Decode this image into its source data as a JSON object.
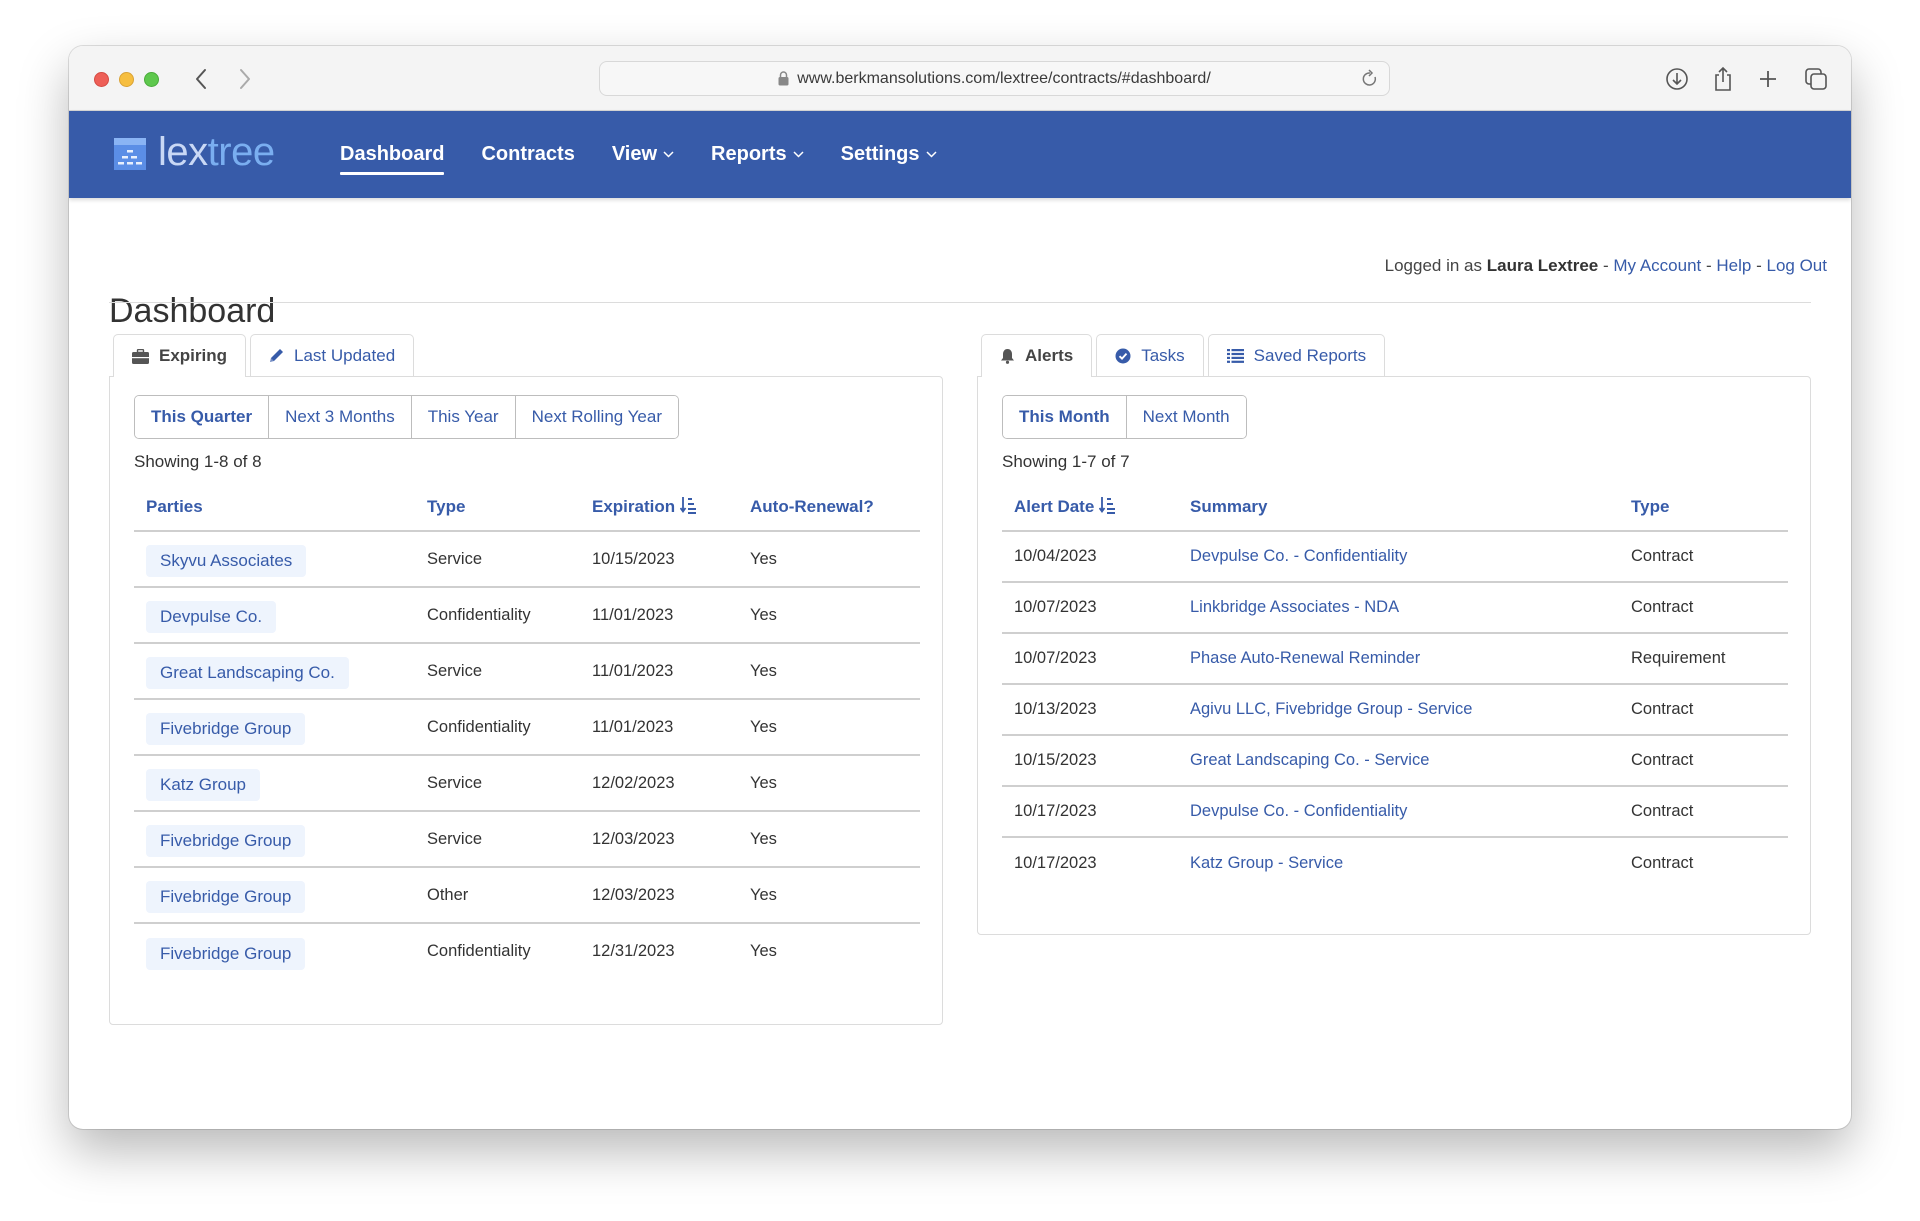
{
  "browser": {
    "url": "www.berkmansolutions.com/lextree/contracts/#dashboard/"
  },
  "app": {
    "logo": {
      "part1": "lex",
      "part2": "tree"
    },
    "nav": [
      {
        "label": "Dashboard",
        "active": true,
        "dropdown": false
      },
      {
        "label": "Contracts",
        "active": false,
        "dropdown": false
      },
      {
        "label": "View",
        "active": false,
        "dropdown": true
      },
      {
        "label": "Reports",
        "active": false,
        "dropdown": true
      },
      {
        "label": "Settings",
        "active": false,
        "dropdown": true
      }
    ],
    "colors": {
      "brand": "#375ba9",
      "badge_bg": "#eef4fd"
    }
  },
  "userbar": {
    "prefix": "Logged in as",
    "user": "Laura Lextree",
    "sep": "-",
    "links": [
      "My Account",
      "Help",
      "Log Out"
    ]
  },
  "page": {
    "title": "Dashboard"
  },
  "left_panel": {
    "tabs": [
      {
        "label": "Expiring",
        "icon": "briefcase-icon",
        "active": true
      },
      {
        "label": "Last Updated",
        "icon": "pencil-icon",
        "active": false
      }
    ],
    "filters": [
      {
        "label": "This Quarter",
        "active": true
      },
      {
        "label": "Next 3 Months",
        "active": false
      },
      {
        "label": "This Year",
        "active": false
      },
      {
        "label": "Next Rolling Year",
        "active": false
      }
    ],
    "showing": "Showing 1-8 of 8",
    "columns": [
      "Parties",
      "Type",
      "Expiration",
      "Auto-Renewal?"
    ],
    "rows": [
      {
        "party": "Skyvu Associates",
        "type": "Service",
        "expiration": "10/15/2023",
        "auto_renewal": "Yes"
      },
      {
        "party": "Devpulse Co.",
        "type": "Confidentiality",
        "expiration": "11/01/2023",
        "auto_renewal": "Yes"
      },
      {
        "party": "Great Landscaping Co.",
        "type": "Service",
        "expiration": "11/01/2023",
        "auto_renewal": "Yes"
      },
      {
        "party": "Fivebridge Group",
        "type": "Confidentiality",
        "expiration": "11/01/2023",
        "auto_renewal": "Yes"
      },
      {
        "party": "Katz Group",
        "type": "Service",
        "expiration": "12/02/2023",
        "auto_renewal": "Yes"
      },
      {
        "party": "Fivebridge Group",
        "type": "Service",
        "expiration": "12/03/2023",
        "auto_renewal": "Yes"
      },
      {
        "party": "Fivebridge Group",
        "type": "Other",
        "expiration": "12/03/2023",
        "auto_renewal": "Yes"
      },
      {
        "party": "Fivebridge Group",
        "type": "Confidentiality",
        "expiration": "12/31/2023",
        "auto_renewal": "Yes"
      }
    ]
  },
  "right_panel": {
    "tabs": [
      {
        "label": "Alerts",
        "icon": "bell-icon",
        "active": true
      },
      {
        "label": "Tasks",
        "icon": "check-circle-icon",
        "active": false
      },
      {
        "label": "Saved Reports",
        "icon": "list-icon",
        "active": false
      }
    ],
    "filters": [
      {
        "label": "This Month",
        "active": true
      },
      {
        "label": "Next Month",
        "active": false
      }
    ],
    "showing": "Showing 1-7 of 7",
    "columns": [
      "Alert Date",
      "Summary",
      "Type"
    ],
    "rows": [
      {
        "date": "10/04/2023",
        "summary": "Devpulse Co. - Confidentiality",
        "type": "Contract"
      },
      {
        "date": "10/07/2023",
        "summary": "Linkbridge Associates - NDA",
        "type": "Contract"
      },
      {
        "date": "10/07/2023",
        "summary": "Phase Auto-Renewal Reminder",
        "type": "Requirement"
      },
      {
        "date": "10/13/2023",
        "summary": "Agivu LLC, Fivebridge Group - Service",
        "type": "Contract"
      },
      {
        "date": "10/15/2023",
        "summary": "Great Landscaping Co. - Service",
        "type": "Contract"
      },
      {
        "date": "10/17/2023",
        "summary": "Devpulse Co. - Confidentiality",
        "type": "Contract"
      },
      {
        "date": "10/17/2023",
        "summary": "Katz Group - Service",
        "type": "Contract"
      }
    ]
  }
}
